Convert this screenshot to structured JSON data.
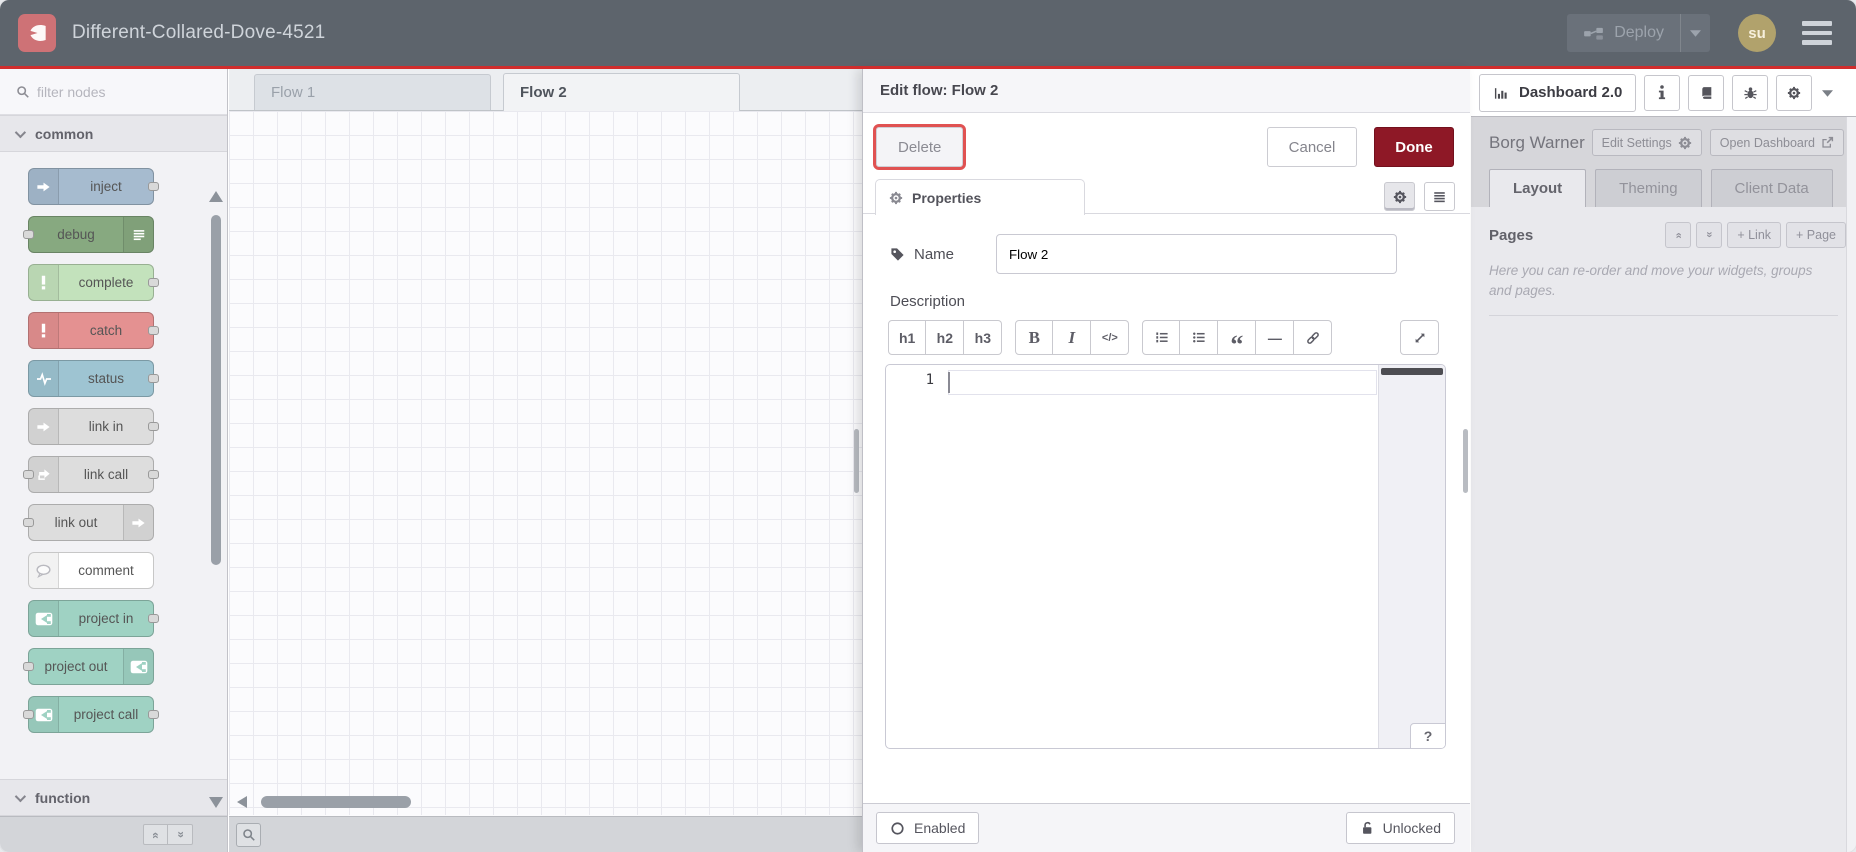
{
  "header": {
    "title": "Different-Collared-Dove-4521",
    "deploy_label": "Deploy",
    "avatar_initials": "su"
  },
  "palette": {
    "filter_placeholder": "filter nodes",
    "sections": [
      {
        "label": "common"
      },
      {
        "label": "function"
      }
    ],
    "nodes": [
      {
        "label": "inject",
        "icon": "inject-icon",
        "icon_side": "left",
        "color": "#a6bbcf",
        "ports": [
          "right"
        ]
      },
      {
        "label": "debug",
        "icon": "debug-icon",
        "icon_side": "right",
        "color": "#87a980",
        "ports": [
          "left"
        ]
      },
      {
        "label": "complete",
        "icon": "exclamation-icon",
        "icon_side": "left",
        "color": "#c3e2bc",
        "ports": [
          "right"
        ]
      },
      {
        "label": "catch",
        "icon": "exclamation-icon",
        "icon_side": "left",
        "color": "#e49191",
        "ports": [
          "right"
        ]
      },
      {
        "label": "status",
        "icon": "pulse-icon",
        "icon_side": "left",
        "color": "#9ec4d2",
        "ports": [
          "right"
        ]
      },
      {
        "label": "link in",
        "icon": "link-arrow-icon",
        "icon_side": "left",
        "color": "#dddddd",
        "ports": [
          "right"
        ]
      },
      {
        "label": "link call",
        "icon": "link-call-icon",
        "icon_side": "left",
        "color": "#dddddd",
        "ports": [
          "left",
          "right"
        ]
      },
      {
        "label": "link out",
        "icon": "link-arrow-icon",
        "icon_side": "right",
        "color": "#dddddd",
        "ports": [
          "left"
        ]
      },
      {
        "label": "comment",
        "icon": "comment-icon",
        "icon_side": "left",
        "color": "#ffffff",
        "ports": []
      },
      {
        "label": "project in",
        "icon": "node-red-icon",
        "icon_side": "left",
        "color": "#9fd2c3",
        "ports": [
          "right"
        ]
      },
      {
        "label": "project out",
        "icon": "node-red-icon",
        "icon_side": "right",
        "color": "#9fd2c3",
        "ports": [
          "left"
        ]
      },
      {
        "label": "project call",
        "icon": "node-red-icon",
        "icon_side": "left",
        "color": "#9fd2c3",
        "ports": [
          "left",
          "right"
        ]
      }
    ]
  },
  "workspace": {
    "active_tab": "Flow 2",
    "tabs": [
      {
        "label": "Flow 1"
      },
      {
        "label": "Flow 2"
      }
    ]
  },
  "dialog": {
    "title": "Edit flow: Flow 2",
    "delete_label": "Delete",
    "cancel_label": "Cancel",
    "done_label": "Done",
    "properties_tab": "Properties",
    "name_label": "Name",
    "name_value": "Flow 2",
    "description_label": "Description",
    "toolbar_groups": [
      {
        "buttons": [
          {
            "name": "h1",
            "label": "h1"
          },
          {
            "name": "h2",
            "label": "h2"
          },
          {
            "name": "h3",
            "label": "h3"
          }
        ]
      },
      {
        "buttons": [
          {
            "name": "bold",
            "label": "B"
          },
          {
            "name": "italic",
            "label": "I"
          },
          {
            "name": "code",
            "label": "</>"
          }
        ]
      },
      {
        "buttons": [
          {
            "name": "ordered-list",
            "label": ""
          },
          {
            "name": "unordered-list",
            "label": ""
          },
          {
            "name": "quote",
            "label": "“"
          },
          {
            "name": "horizontal-rule",
            "label": "—"
          },
          {
            "name": "link",
            "label": ""
          }
        ]
      }
    ],
    "editor": {
      "line_number": "1",
      "help_button": "?"
    },
    "footer": {
      "enabled_label": "Enabled",
      "lock_label": "Unlocked"
    }
  },
  "sidebar": {
    "active_tab": "Dashboard 2.0",
    "project_label": "Borg Warner",
    "edit_settings_label": "Edit Settings",
    "open_dashboard_label": "Open Dashboard",
    "active_subtab": "Layout",
    "tabs": [
      {
        "label": "Layout"
      },
      {
        "label": "Theming"
      },
      {
        "label": "Client Data"
      }
    ],
    "pages": {
      "title": "Pages",
      "link_button": "+ Link",
      "page_button": "+ Page",
      "help_text": "Here you can re-order and move your widgets, groups and pages."
    }
  },
  "colors": {
    "header_bg": "#5d646c",
    "accent_red": "#d12d2d",
    "done_red": "#8e1826",
    "delete_outline": "#e05252",
    "avatar_bg": "#b1a26c"
  }
}
